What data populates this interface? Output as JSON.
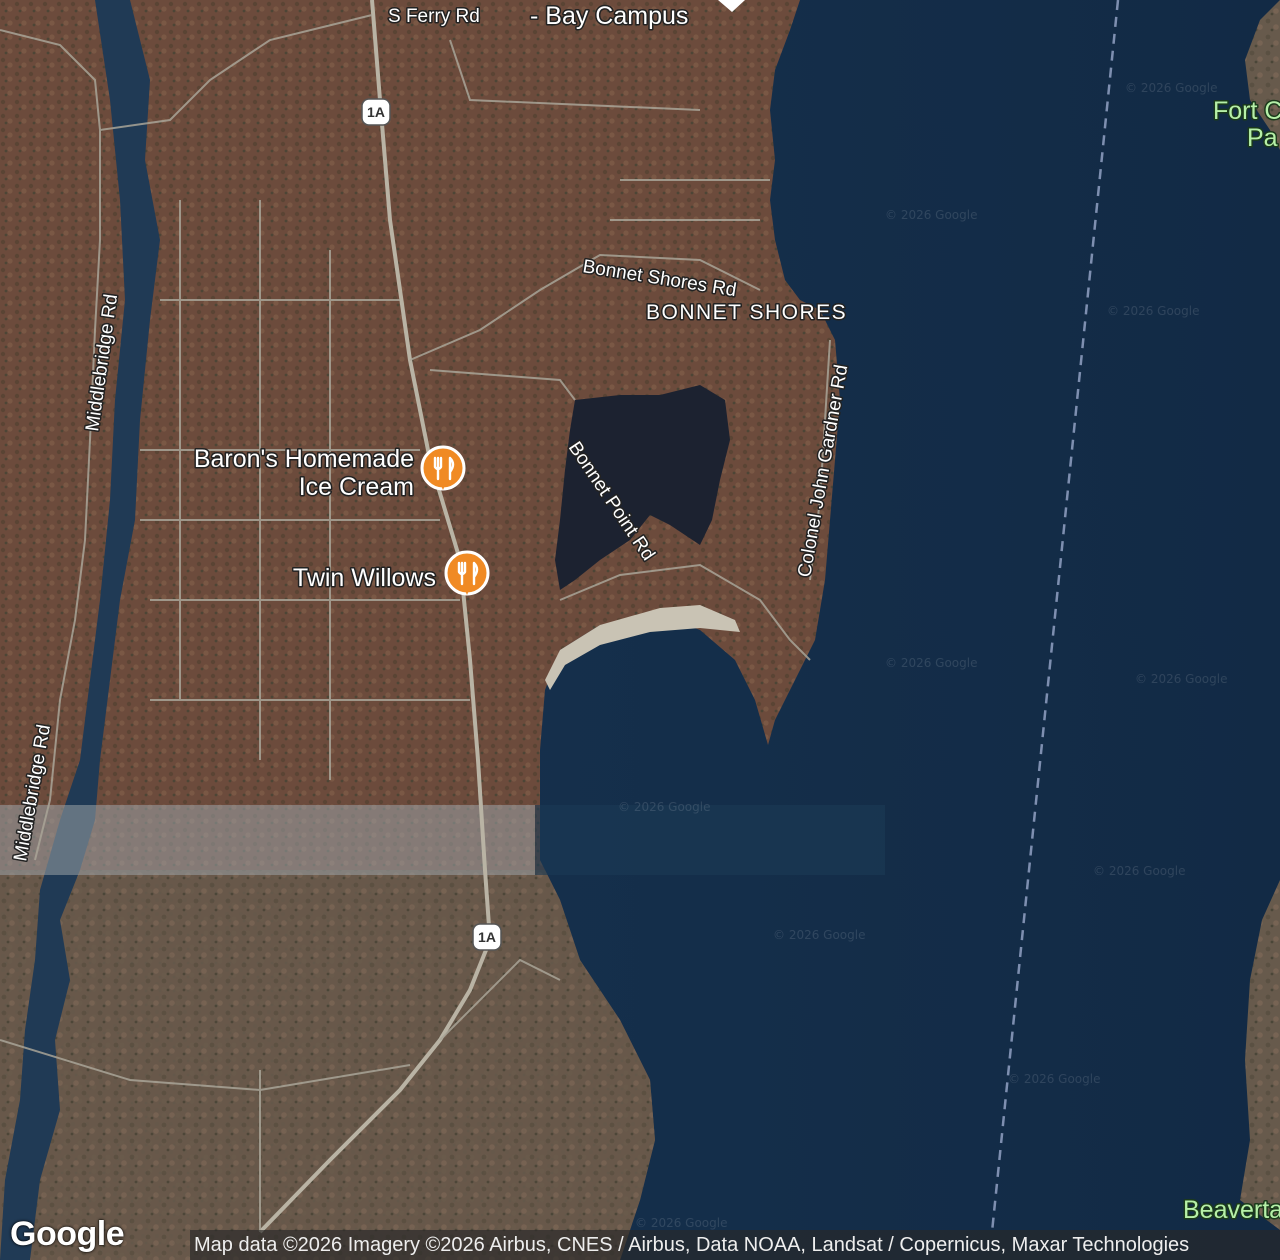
{
  "map": {
    "labels": {
      "s_ferry_rd": "S Ferry Rd",
      "bay_campus": "- Bay Campus",
      "bonnet_shores_rd": "Bonnet Shores Rd",
      "bonnet_shores": "BONNET SHORES",
      "middlebridge_rd_1": "Middlebridge Rd",
      "middlebridge_rd_2": "Middlebridge Rd",
      "bonnet_point_rd": "Bonnet Point Rd",
      "colonel_john_gardner_rd": "Colonel John Gardner Rd",
      "fort_line1": "Fort C",
      "fort_line2": "Pa",
      "beavertail": "Beaverta",
      "route_1a_top": "1A",
      "route_1a_bottom": "1A"
    },
    "pois": [
      {
        "name_line1": "Baron's Homemade",
        "name_line2": "Ice Cream",
        "icon": "restaurant-icon"
      },
      {
        "name_line1": "Twin Willows",
        "icon": "restaurant-icon"
      }
    ],
    "watermark": "© 2026 Google"
  },
  "footer": {
    "logo": "Google",
    "attribution": "Map data ©2026 Imagery ©2026 Airbus, CNES / Airbus, Data NOAA, Landsat / Copernicus, Maxar Technologies"
  },
  "colors": {
    "water": "#152f4b",
    "land": "#6b5040",
    "poi_orange": "#f08a24",
    "route_line": "#7e8fb0"
  }
}
